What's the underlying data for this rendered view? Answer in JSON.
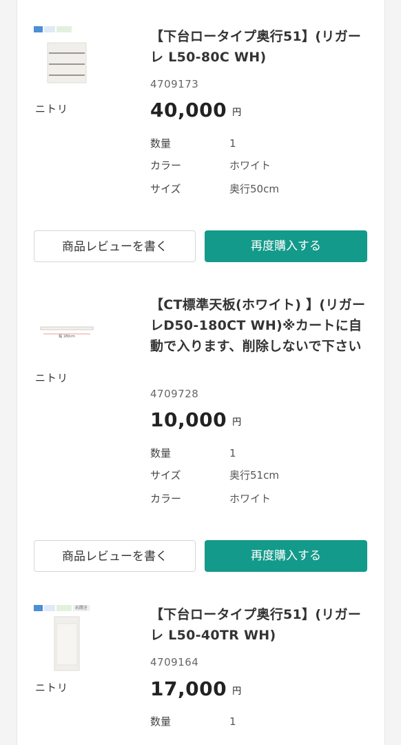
{
  "products": [
    {
      "brand": "ニトリ",
      "title": "【下台ロータイプ奥行51】(リガーレ L50-80C WH)",
      "code": "4709173",
      "price": "40,000",
      "currency": "円",
      "attrs": [
        {
          "key": "数量",
          "value": "1"
        },
        {
          "key": "カラー",
          "value": "ホワイト"
        },
        {
          "key": "サイズ",
          "value": "奥行50cm"
        }
      ],
      "review_label": "商品レビューを書く",
      "rebuy_label": "再度購入する"
    },
    {
      "brand": "ニトリ",
      "title": "【CT標準天板(ホワイト) 】(リガーレD50-180CT WH)※カートに自動で入ります、削除しないで下さい",
      "code": "4709728",
      "price": "10,000",
      "currency": "円",
      "thumb_label": "幅 180cm",
      "attrs": [
        {
          "key": "数量",
          "value": "1"
        },
        {
          "key": "サイズ",
          "value": "奥行51cm"
        },
        {
          "key": "カラー",
          "value": "ホワイト"
        }
      ],
      "review_label": "商品レビューを書く",
      "rebuy_label": "再度購入する"
    },
    {
      "brand": "ニトリ",
      "title": "【下台ロータイプ奥行51】(リガーレ L50-40TR WH)",
      "code": "4709164",
      "price": "17,000",
      "currency": "円",
      "thumb_tag": "右開き",
      "attrs": [
        {
          "key": "数量",
          "value": "1"
        }
      ]
    }
  ],
  "colors": {
    "accent": "#139a8a",
    "page_bg": "#f4f4f4"
  }
}
